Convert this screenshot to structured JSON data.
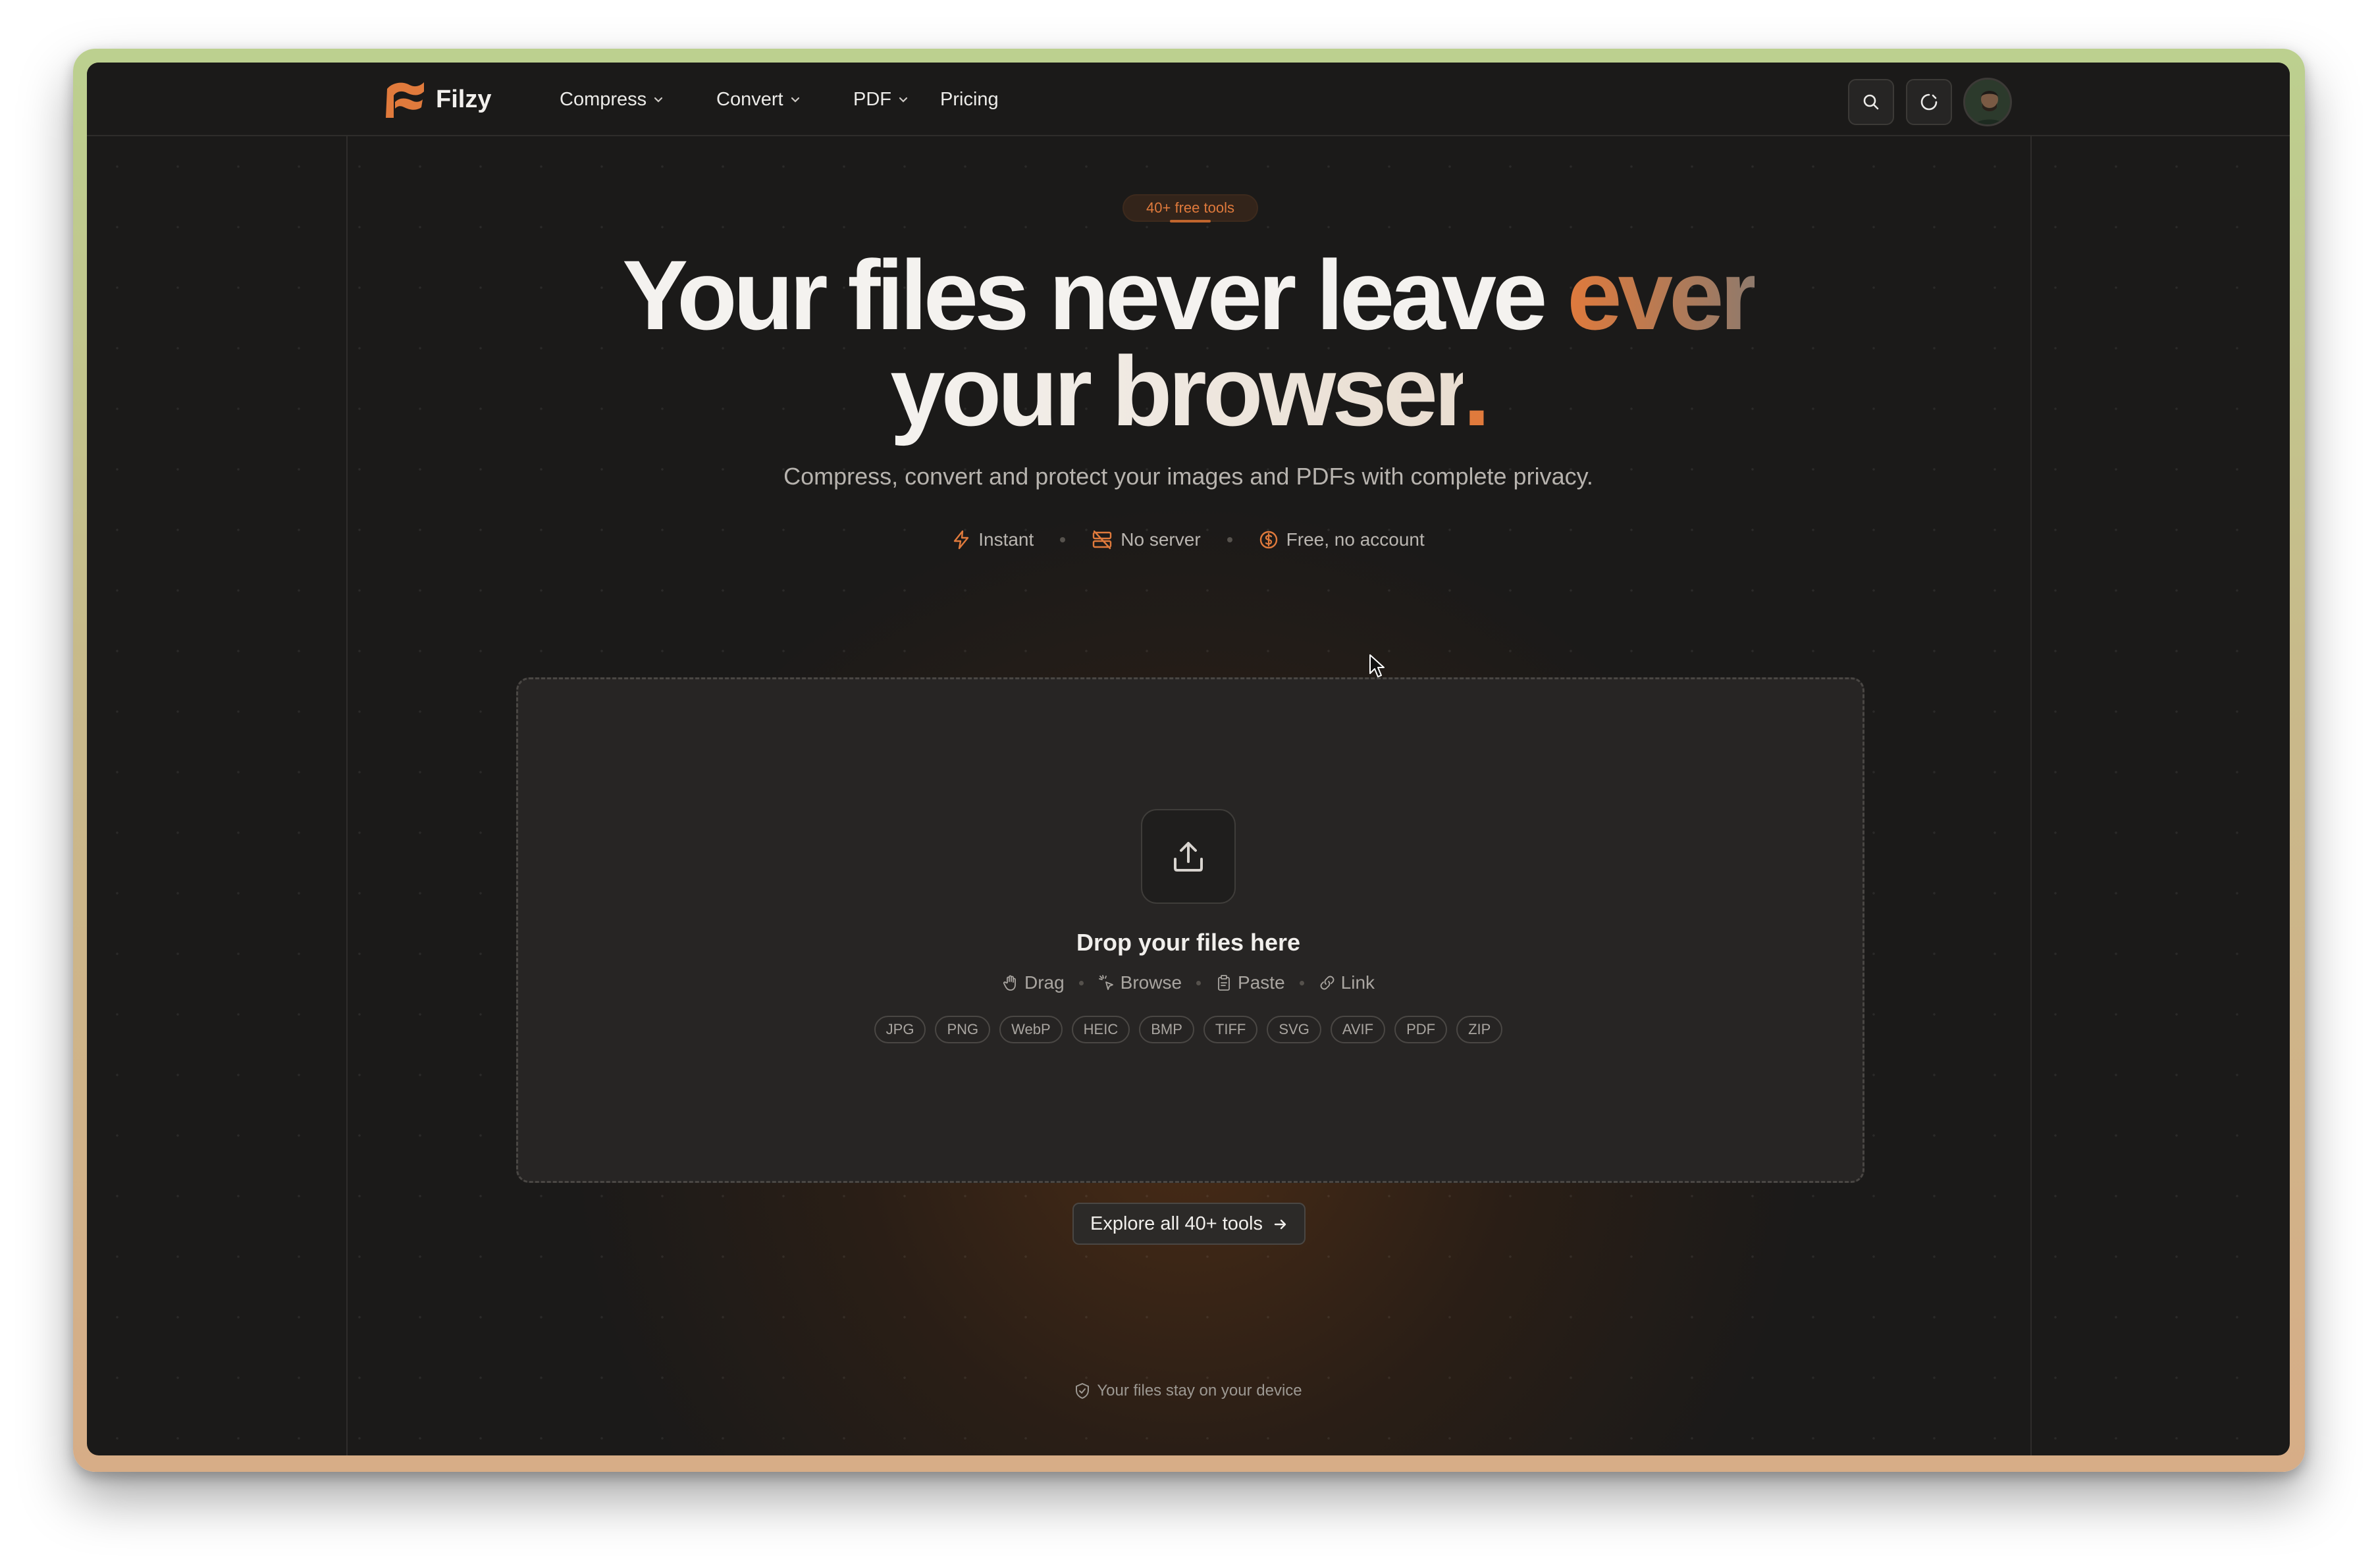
{
  "nav": {
    "brand": "Filzy",
    "menu": [
      {
        "label": "Compress",
        "has_dropdown": true
      },
      {
        "label": "Convert",
        "has_dropdown": true
      },
      {
        "label": "PDF",
        "has_dropdown": true
      },
      {
        "label": "Pricing",
        "has_dropdown": false
      }
    ],
    "icons": [
      "search-icon",
      "theme-toggle-icon",
      "avatar"
    ]
  },
  "hero": {
    "badge": "40+ free tools",
    "headline_part1": "Your files never leave ",
    "headline_accent": "ever",
    "headline_line2": "your browser",
    "headline_period": ".",
    "subtitle": "Compress, convert and protect your images and PDFs with complete privacy.",
    "features": [
      {
        "icon": "lightning-icon",
        "label": "Instant"
      },
      {
        "icon": "server-off-icon",
        "label": "No server"
      },
      {
        "icon": "coin-icon",
        "label": "Free, no account"
      }
    ]
  },
  "dropzone": {
    "title": "Drop your files here",
    "methods": [
      {
        "icon": "hand-icon",
        "label": "Drag"
      },
      {
        "icon": "pointer-click-icon",
        "label": "Browse"
      },
      {
        "icon": "clipboard-icon",
        "label": "Paste"
      },
      {
        "icon": "link-icon",
        "label": "Link"
      }
    ],
    "formats": [
      "JPG",
      "PNG",
      "WebP",
      "HEIC",
      "BMP",
      "TIFF",
      "SVG",
      "AVIF",
      "PDF",
      "ZIP"
    ]
  },
  "explore_button": "Explore all 40+ tools",
  "footer_note": "Your files stay on your device",
  "colors": {
    "accent": "#e07a3c",
    "background": "#1b1a19",
    "surface": "#272524"
  }
}
